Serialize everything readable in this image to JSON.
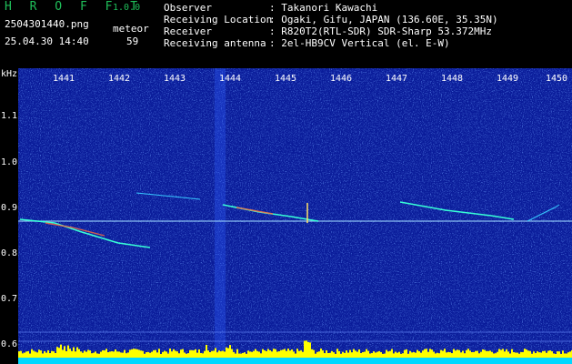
{
  "header": {
    "app_title": "H R O F F T",
    "version": "1.0.0",
    "filename": "2504301440.png",
    "datetime": "25.04.30 14:40",
    "meteor_label": "meteor",
    "meteor_count": "59"
  },
  "info": [
    {
      "label": "Observer",
      "value": ": Takanori Kawachi"
    },
    {
      "label": "Receiving Location",
      "value": ": Ogaki, Gifu, JAPAN (136.60E, 35.35N)"
    },
    {
      "label": "Receiver",
      "value": ": R820T2(RTL-SDR) SDR-Sharp 53.372MHz"
    },
    {
      "label": "Receiving antenna",
      "value": ": 2el-HB9CV Vertical (el. E-W)"
    }
  ],
  "spectrogram": {
    "y_unit": "kHz",
    "y_ticks": [
      "1.1",
      "1.0",
      "0.9",
      "0.8",
      "0.7",
      "0.6"
    ],
    "x_ticks": [
      "1441",
      "1442",
      "1443",
      "1444",
      "1445",
      "1446",
      "1447",
      "1448",
      "1449",
      "1450"
    ],
    "colors": {
      "background": "#0a1c9a",
      "signal": "#00ffff",
      "bars": "#ffff00"
    }
  }
}
